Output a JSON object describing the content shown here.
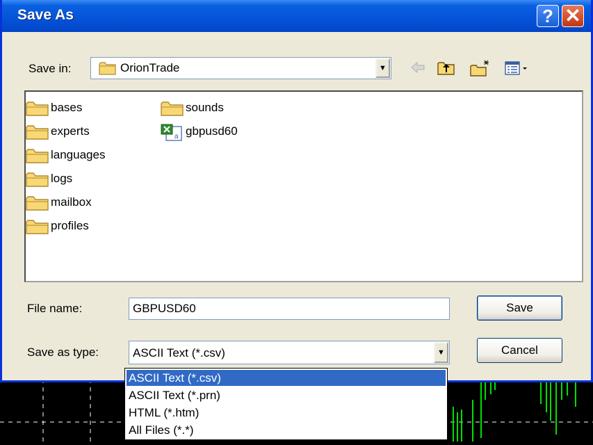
{
  "window": {
    "title": "Save As"
  },
  "titlebar": {
    "help_label": "?",
    "close_label": "✕"
  },
  "save_in": {
    "label": "Save in:",
    "value": "OrionTrade"
  },
  "toolbar_icons": [
    "back-arrow-icon",
    "up-folder-icon",
    "new-folder-icon",
    "view-menu-icon"
  ],
  "files": [
    {
      "name": "bases",
      "type": "folder"
    },
    {
      "name": "experts",
      "type": "folder"
    },
    {
      "name": "languages",
      "type": "folder"
    },
    {
      "name": "logs",
      "type": "folder"
    },
    {
      "name": "mailbox",
      "type": "folder"
    },
    {
      "name": "profiles",
      "type": "folder"
    },
    {
      "name": "sounds",
      "type": "folder"
    },
    {
      "name": "gbpusd60",
      "type": "csv-file"
    }
  ],
  "file_name": {
    "label": "File name:",
    "value": "GBPUSD60"
  },
  "save_as_type": {
    "label": "Save as type:",
    "value": "ASCII Text (*.csv)",
    "options": [
      "ASCII Text (*.csv)",
      "ASCII Text (*.prn)",
      "HTML (*.htm)",
      "All Files (*.*)"
    ],
    "selected_index": 0
  },
  "buttons": {
    "save": "Save",
    "cancel": "Cancel"
  },
  "colors": {
    "titlebar": "#0553d8",
    "dialog_bg": "#ece9d8",
    "selection": "#316ac5",
    "chart_bars": "#00e000"
  }
}
